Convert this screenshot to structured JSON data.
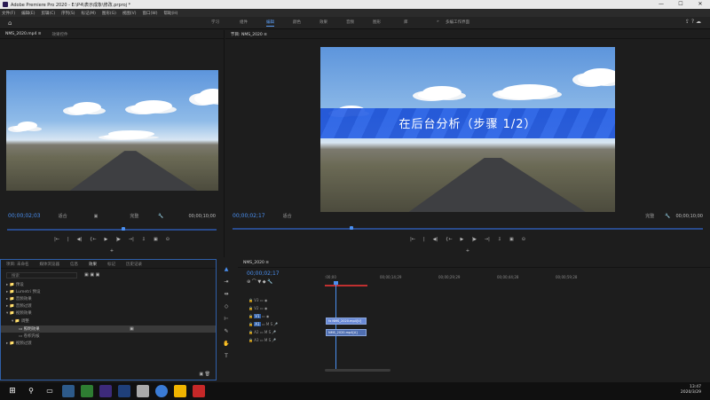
{
  "window": {
    "title": "Adobe Premiere Pro 2020 - E:\\P4\\表示成象\\修改.prproj *",
    "controls": [
      "—",
      "☐",
      "✕"
    ]
  },
  "menu": [
    "文件(F)",
    "编辑(E)",
    "剪辑(C)",
    "序列(S)",
    "标记(M)",
    "图形(G)",
    "视图(V)",
    "窗口(W)",
    "帮助(H)"
  ],
  "workspace": {
    "tabs": [
      "学习",
      "组件",
      "编辑",
      "颜色",
      "效果",
      "音频",
      "图形",
      "库"
    ],
    "active_index": 2,
    "more": "»",
    "more_label": "多编工作界面"
  },
  "source": {
    "tab1": "NMS_2020.mp4 ≡",
    "tab2": "效果控件",
    "timecode": "00;00;02;03",
    "fit": "适合",
    "quality": "完整",
    "duration": "00;00;10;00"
  },
  "program": {
    "tab": "节目: NMS_2020 ≡",
    "timecode": "00;00;02;17",
    "fit": "适合",
    "quality": "完整",
    "duration": "00;00;10;00",
    "overlay_text": "在后台分析（步骤 1/2）"
  },
  "transport": [
    "{←",
    "|",
    "|←",
    "◀|",
    "▶",
    "|▶",
    "→|",
    "⇩",
    "▣",
    "⊙",
    "+"
  ],
  "project": {
    "tabs": [
      "项目: 未命名",
      "媒体浏览器",
      "库",
      "信息",
      "效果",
      "标记",
      "历史记录"
    ],
    "active_tab": 4,
    "search_placeholder": "搜索",
    "tree": [
      {
        "label": "▸ 📁 预设",
        "indent": 0
      },
      {
        "label": "▸ 📁 Lumetri 预设",
        "indent": 0
      },
      {
        "label": "▸ 📁 音频效果",
        "indent": 0
      },
      {
        "label": "▸ 📁 音频过渡",
        "indent": 0
      },
      {
        "label": "▾ 📁 视频效果",
        "indent": 0
      },
      {
        "label": "▾ 📁 调整",
        "indent": 1
      },
      {
        "label": "▭ 照明效果",
        "indent": 2
      },
      {
        "label": "▭ 卷积内核",
        "indent": 2
      },
      {
        "label": "▸ 📁 视频过渡",
        "indent": 0
      }
    ]
  },
  "timeline": {
    "tab": "NMS_2020 ≡",
    "timecode": "00;00;02;17",
    "ruler": [
      ":00;00",
      "00;00;14;29",
      "00;00;29;29",
      "00;00;44;28",
      "00;00;59;28"
    ],
    "tracks": [
      "V3",
      "V2",
      "V1",
      "A1",
      "A2",
      "A3"
    ],
    "clips": [
      {
        "label": "fx NMS_2020.mp4[V]",
        "track": "V1"
      },
      {
        "label": "NMS_2020.mp4[A]",
        "track": "A1"
      }
    ]
  },
  "taskbar": {
    "time": "13:47",
    "date": "2020/3/29"
  }
}
